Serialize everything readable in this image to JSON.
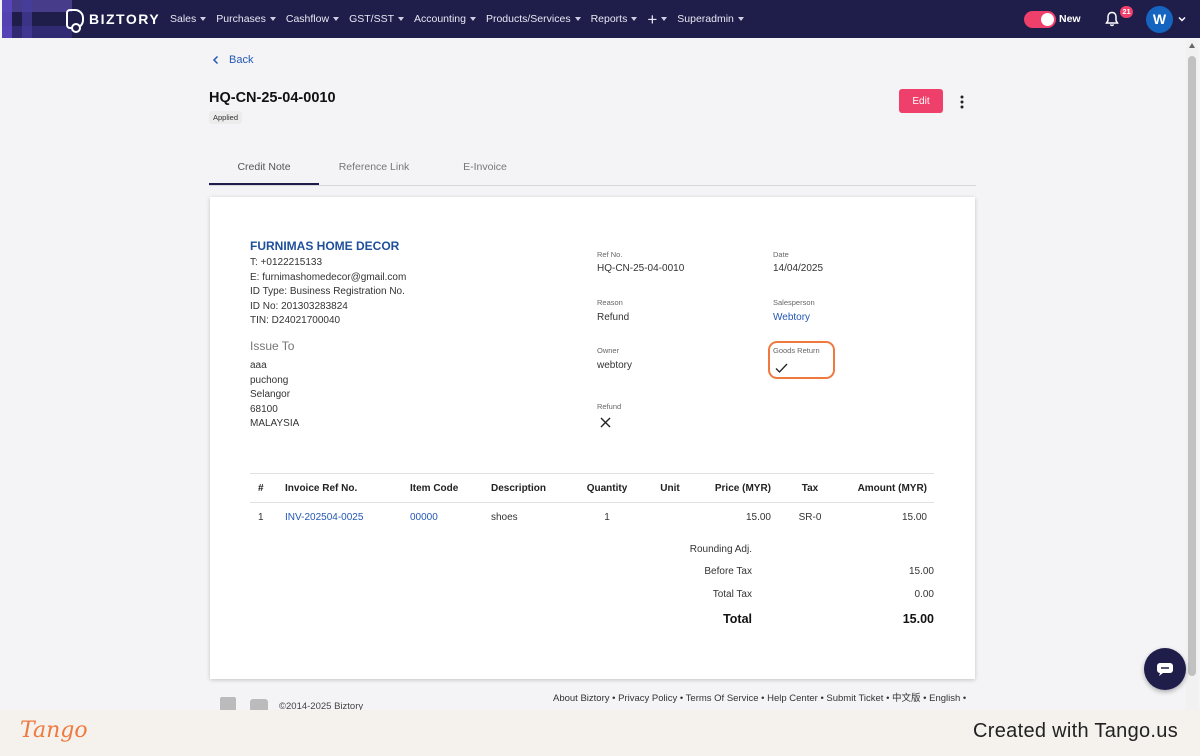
{
  "nav": {
    "brand": "BIZTORY",
    "menu": [
      {
        "label": "Sales"
      },
      {
        "label": "Purchases"
      },
      {
        "label": "Cashflow"
      },
      {
        "label": "GST/SST"
      },
      {
        "label": "Accounting"
      },
      {
        "label": "Products/Services"
      },
      {
        "label": "Reports"
      },
      {
        "label": "+"
      },
      {
        "label": "Superadmin"
      }
    ],
    "toggle_label": "New",
    "notification_count": "21",
    "avatar_initial": "W",
    "accent_color": "#ef3f6b",
    "nav_bg": "#1f1d4a"
  },
  "header": {
    "back_label": "Back",
    "title": "HQ-CN-25-04-0010",
    "status": "Applied",
    "edit_label": "Edit"
  },
  "tabs": [
    {
      "label": "Credit Note",
      "active": true
    },
    {
      "label": "Reference Link",
      "active": false
    },
    {
      "label": "E-Invoice",
      "active": false
    }
  ],
  "company": {
    "name": "FURNIMAS HOME DECOR",
    "phone": "T: +0122215133",
    "email": "E: furnimashomedecor@gmail.com",
    "id_type": "ID Type: Business Registration No.",
    "id_no": "ID No: 201303283824",
    "tin": "TIN: D24021700040"
  },
  "issue_to": {
    "title": "Issue To",
    "lines": [
      "aaa",
      "puchong",
      "Selangor",
      "68100",
      "MALAYSIA"
    ]
  },
  "fields": {
    "ref_no": {
      "label": "Ref No.",
      "value": "HQ-CN-25-04-0010"
    },
    "date": {
      "label": "Date",
      "value": "14/04/2025"
    },
    "reason": {
      "label": "Reason",
      "value": "Refund"
    },
    "salesperson": {
      "label": "Salesperson",
      "value": "Webtory"
    },
    "owner": {
      "label": "Owner",
      "value": "webtory"
    },
    "goods_return": {
      "label": "Goods Return",
      "value_icon": "check-icon"
    },
    "refund": {
      "label": "Refund",
      "value_icon": "x-icon"
    }
  },
  "table": {
    "headers": [
      "#",
      "Invoice Ref No.",
      "Item Code",
      "Description",
      "Quantity",
      "Unit",
      "Price (MYR)",
      "Tax",
      "Amount (MYR)"
    ],
    "rows": [
      {
        "no": "1",
        "invoice_ref": "INV-202504-0025",
        "item_code": "00000",
        "description": "shoes",
        "quantity": "1",
        "unit": "",
        "price": "15.00",
        "tax": "SR-0",
        "amount": "15.00"
      }
    ]
  },
  "summary": {
    "rounding_label": "Rounding Adj.",
    "rounding_value": "",
    "before_tax_label": "Before Tax",
    "before_tax_value": "15.00",
    "total_tax_label": "Total Tax",
    "total_tax_value": "0.00",
    "total_label": "Total",
    "total_value": "15.00"
  },
  "footer": {
    "copyright": "©2014-2025 Biztory",
    "links": "About Biztory • Privacy Policy • Terms Of Service • Help Center • Submit Ticket • 中文版 • English •"
  },
  "tango": {
    "logo": "Tango",
    "created": "Created with Tango.us"
  }
}
